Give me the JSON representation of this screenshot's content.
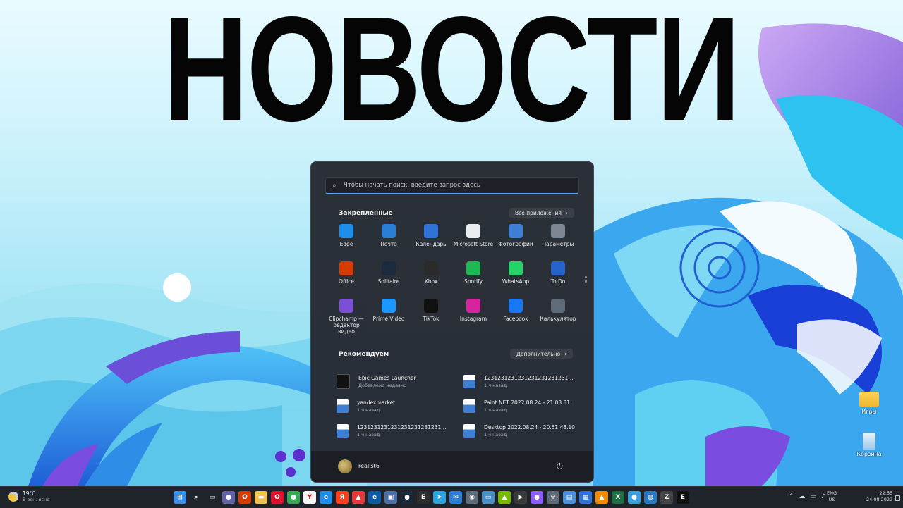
{
  "headline": "НОВОСТИ",
  "desktop_icons": [
    {
      "label": "Игры",
      "icon": "folder-icon"
    },
    {
      "label": "Корзина",
      "icon": "recycle-bin-icon"
    }
  ],
  "start_menu": {
    "search_placeholder": "Чтобы начать поиск, введите запрос здесь",
    "pinned_title": "Закрепленные",
    "all_apps_label": "Все приложения",
    "pinned": [
      {
        "label": "Edge",
        "icon": "edge-icon",
        "color": "#1f8ee8"
      },
      {
        "label": "Почта",
        "icon": "mail-icon",
        "color": "#2a7fd4"
      },
      {
        "label": "Календарь",
        "icon": "calendar-icon",
        "color": "#2f73d9"
      },
      {
        "label": "Microsoft Store",
        "icon": "store-icon",
        "color": "#e9ecef"
      },
      {
        "label": "Фотографии",
        "icon": "photos-icon",
        "color": "#3d7fd6"
      },
      {
        "label": "Параметры",
        "icon": "gear-icon",
        "color": "#7c8793"
      },
      {
        "label": "Office",
        "icon": "office-icon",
        "color": "#d83b01"
      },
      {
        "label": "Solitaire",
        "icon": "solitaire-icon",
        "color": "#1c2a3d"
      },
      {
        "label": "Xbox",
        "icon": "xbox-icon",
        "color": "#2b2b2b"
      },
      {
        "label": "Spotify",
        "icon": "spotify-icon",
        "color": "#1db954"
      },
      {
        "label": "WhatsApp",
        "icon": "whatsapp-icon",
        "color": "#25d366"
      },
      {
        "label": "To Do",
        "icon": "todo-icon",
        "color": "#2564cf"
      },
      {
        "label": "Clipchamp — редактор видео",
        "icon": "clipchamp-icon",
        "color": "#7b4fd6"
      },
      {
        "label": "Prime Video",
        "icon": "prime-video-icon",
        "color": "#1a98ff"
      },
      {
        "label": "TikTok",
        "icon": "tiktok-icon",
        "color": "#111111"
      },
      {
        "label": "Instagram",
        "icon": "instagram-icon",
        "color": "#d6249f"
      },
      {
        "label": "Facebook",
        "icon": "facebook-icon",
        "color": "#1877f2"
      },
      {
        "label": "Калькулятор",
        "icon": "calculator-icon",
        "color": "#5f6b78"
      }
    ],
    "recommended_title": "Рекомендуем",
    "more_label": "Дополнительно",
    "recommended": [
      {
        "name": "Epic Games Launcher",
        "sub": "Добавлено недавно",
        "icon": "epic-games-icon"
      },
      {
        "name": "12312312312312312312312312312312...",
        "sub": "1 ч назад",
        "icon": "image-file-icon"
      },
      {
        "name": "yandexmarket",
        "sub": "1 ч назад",
        "icon": "image-file-icon"
      },
      {
        "name": "Paint.NET 2022.08.24 - 21.03.31.16",
        "sub": "1 ч назад",
        "icon": "image-file-icon"
      },
      {
        "name": "12312312312312312312312312323",
        "sub": "1 ч назад",
        "icon": "image-file-icon"
      },
      {
        "name": "Desktop 2022.08.24 - 20.51.48.10",
        "sub": "1 ч назад",
        "icon": "image-file-icon"
      }
    ],
    "user_name": "realist6"
  },
  "taskbar": {
    "weather_temp": "19°C",
    "weather_desc": "В осн. ясно",
    "apps": [
      {
        "icon": "windows-start-icon",
        "color": "#3b8ee8",
        "glyph": "⊞"
      },
      {
        "icon": "search-icon",
        "color": "#1f232a",
        "glyph": "⌕"
      },
      {
        "icon": "task-view-icon",
        "color": "#1f232a",
        "glyph": "▭"
      },
      {
        "icon": "chat-icon",
        "color": "#6264a7",
        "glyph": "●"
      },
      {
        "icon": "office-icon",
        "color": "#d83b01",
        "glyph": "O"
      },
      {
        "icon": "file-explorer-icon",
        "color": "#f2c14e",
        "glyph": "▬"
      },
      {
        "icon": "opera-icon",
        "color": "#e0102a",
        "glyph": "O"
      },
      {
        "icon": "chrome-icon",
        "color": "#34a853",
        "glyph": "●"
      },
      {
        "icon": "yandex-browser-icon",
        "color": "#f5f5f5",
        "glyph": "Y"
      },
      {
        "icon": "edge-icon",
        "color": "#1f8ee8",
        "glyph": "e"
      },
      {
        "icon": "yandex-icon",
        "color": "#fc3f1d",
        "glyph": "Я"
      },
      {
        "icon": "rocket-icon",
        "color": "#e23b3b",
        "glyph": "▲"
      },
      {
        "icon": "edge-dev-icon",
        "color": "#0c59a4",
        "glyph": "e"
      },
      {
        "icon": "paint-net-icon",
        "color": "#4d6fa8",
        "glyph": "▣"
      },
      {
        "icon": "steam-icon",
        "color": "#1b2838",
        "glyph": "●"
      },
      {
        "icon": "epic-icon",
        "color": "#2c2c2c",
        "glyph": "E"
      },
      {
        "icon": "telegram-icon",
        "color": "#2aa3de",
        "glyph": "➤"
      },
      {
        "icon": "mail-icon",
        "color": "#2a7fd4",
        "glyph": "✉"
      },
      {
        "icon": "camera-icon",
        "color": "#5f6b78",
        "glyph": "◉"
      },
      {
        "icon": "monitor-icon",
        "color": "#4a90c9",
        "glyph": "▭"
      },
      {
        "icon": "nvidia-icon",
        "color": "#76b900",
        "glyph": "▲"
      },
      {
        "icon": "video-icon",
        "color": "#3a3a3a",
        "glyph": "▶"
      },
      {
        "icon": "alice-icon",
        "color": "#8b5cf6",
        "glyph": "●"
      },
      {
        "icon": "gear-icon",
        "color": "#5f6b78",
        "glyph": "⚙"
      },
      {
        "icon": "notepad-icon",
        "color": "#4a90d9",
        "glyph": "▤"
      },
      {
        "icon": "calendar-icon",
        "color": "#2f73d9",
        "glyph": "▦"
      },
      {
        "icon": "vlc-icon",
        "color": "#f28c00",
        "glyph": "▲"
      },
      {
        "icon": "excel-icon",
        "color": "#1d6f42",
        "glyph": "X"
      },
      {
        "icon": "browser-icon",
        "color": "#3aa0e0",
        "glyph": "●"
      },
      {
        "icon": "globe-icon",
        "color": "#2b78c2",
        "glyph": "◍"
      },
      {
        "icon": "zip-icon",
        "color": "#444444",
        "glyph": "Z"
      },
      {
        "icon": "epic-games-icon",
        "color": "#111111",
        "glyph": "E"
      }
    ],
    "lang_1": "ENG",
    "lang_2": "US",
    "time": "22:55",
    "date": "24.08.2022"
  }
}
